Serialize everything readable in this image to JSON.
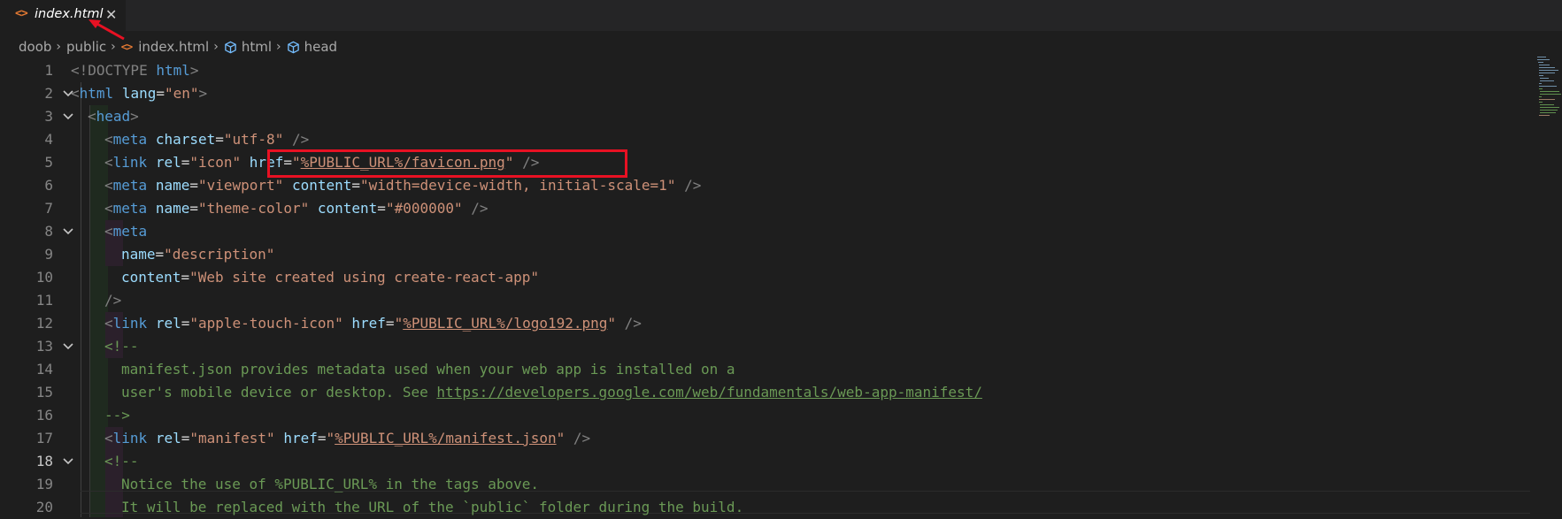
{
  "tab": {
    "icon": "html-file-icon",
    "icon_glyph": "<>",
    "label": "index.html",
    "close_glyph": "✕"
  },
  "breadcrumb": {
    "items": [
      "doob",
      "public",
      "index.html",
      "html",
      "head"
    ],
    "separator": "›"
  },
  "editor": {
    "active_line": 18,
    "lines": [
      {
        "n": "1",
        "fold": false
      },
      {
        "n": "2",
        "fold": true
      },
      {
        "n": "3",
        "fold": true
      },
      {
        "n": "4",
        "fold": false
      },
      {
        "n": "5",
        "fold": false
      },
      {
        "n": "6",
        "fold": false
      },
      {
        "n": "7",
        "fold": false
      },
      {
        "n": "8",
        "fold": true
      },
      {
        "n": "9",
        "fold": false
      },
      {
        "n": "10",
        "fold": false
      },
      {
        "n": "11",
        "fold": false
      },
      {
        "n": "12",
        "fold": false
      },
      {
        "n": "13",
        "fold": true
      },
      {
        "n": "14",
        "fold": false
      },
      {
        "n": "15",
        "fold": false
      },
      {
        "n": "16",
        "fold": false
      },
      {
        "n": "17",
        "fold": false
      },
      {
        "n": "18",
        "fold": true
      },
      {
        "n": "19",
        "fold": false
      },
      {
        "n": "20",
        "fold": false
      }
    ],
    "code": {
      "l1": {
        "open": "<!DOCTYPE",
        "rest": " html",
        "close": ">"
      },
      "l2": {
        "open": "<",
        "tag": "html",
        "a1": "lang",
        "v1": "\"en\"",
        "close": ">"
      },
      "l3": {
        "open": "<",
        "tag": "head",
        "close": ">"
      },
      "l4": {
        "tag": "meta",
        "a1": "charset",
        "v1": "\"utf-8\"",
        "close": "/>"
      },
      "l5": {
        "tag": "link",
        "a1": "rel",
        "v1": "\"icon\"",
        "a2": "href",
        "q": "\"",
        "v2": "%PUBLIC_URL%/favicon.png",
        "close": "/>"
      },
      "l6": {
        "tag": "meta",
        "a1": "name",
        "v1": "\"viewport\"",
        "a2": "content",
        "v2": "\"width=device-width, initial-scale=1\"",
        "close": "/>"
      },
      "l7": {
        "tag": "meta",
        "a1": "name",
        "v1": "\"theme-color\"",
        "a2": "content",
        "v2": "\"#000000\"",
        "close": "/>"
      },
      "l8": {
        "tag": "meta"
      },
      "l9": {
        "a1": "name",
        "v1": "\"description\""
      },
      "l10": {
        "a1": "content",
        "v1": "\"Web site created using create-react-app\""
      },
      "l11": {
        "close": "/>"
      },
      "l12": {
        "tag": "link",
        "a1": "rel",
        "v1": "\"apple-touch-icon\"",
        "a2": "href",
        "v2": "%PUBLIC_URL%/logo192.png",
        "close": "/>"
      },
      "l13": {
        "text": "<!--"
      },
      "l14": {
        "text": "manifest.json provides metadata used when your web app is installed on a"
      },
      "l15": {
        "text": "user's mobile device or desktop. See ",
        "link": "https://developers.google.com/web/fundamentals/web-app-manifest/"
      },
      "l16": {
        "text": "-->"
      },
      "l17": {
        "tag": "link",
        "a1": "rel",
        "v1": "\"manifest\"",
        "a2": "href",
        "v2": "%PUBLIC_URL%/manifest.json",
        "close": "/>"
      },
      "l18": {
        "text": "<!--"
      },
      "l19": {
        "text": "Notice the use of %PUBLIC_URL% in the tags above."
      },
      "l20": {
        "text": "It will be replaced with the URL of the `public` folder during the build."
      }
    }
  },
  "annotations": {
    "highlight_color": "#e81123",
    "arrow_color": "#e81123"
  }
}
